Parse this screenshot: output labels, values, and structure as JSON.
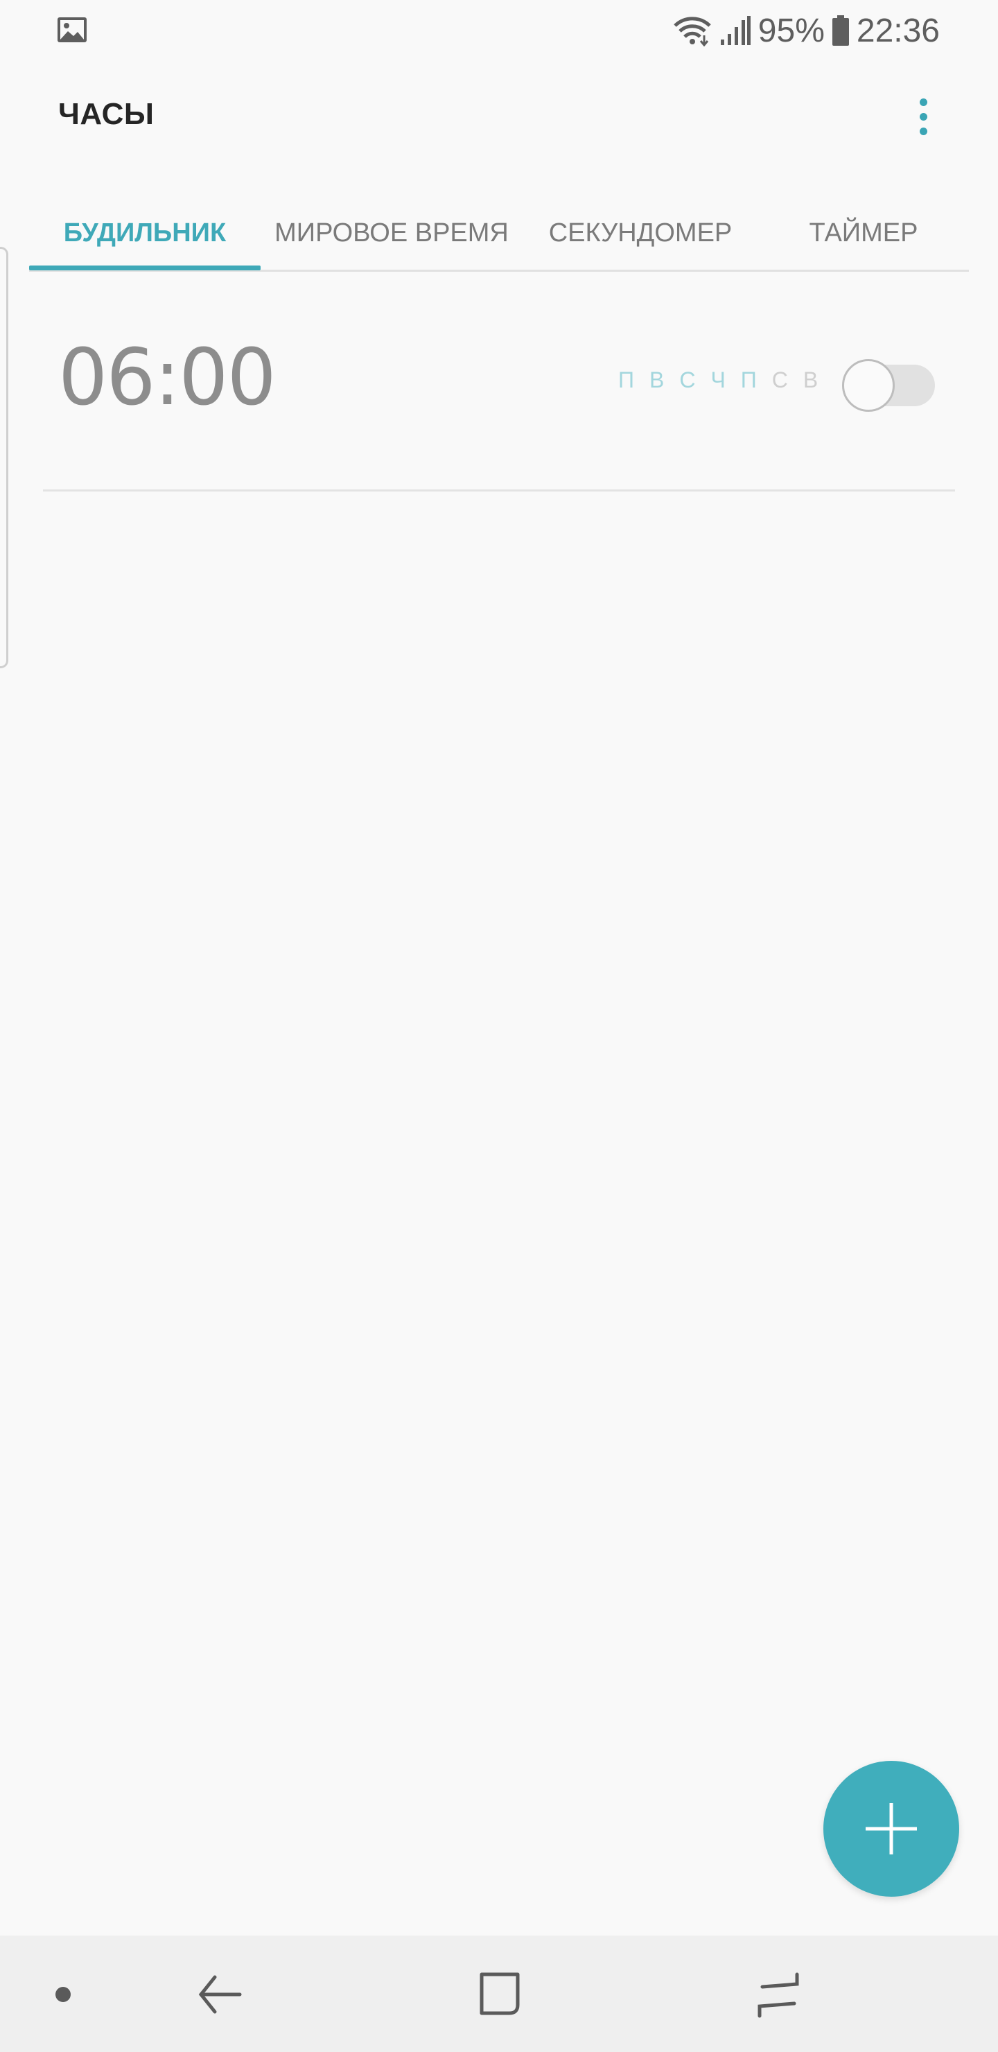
{
  "status_bar": {
    "left_icon": "image-icon",
    "wifi_icon": "wifi-icon",
    "signal_icon": "signal-icon",
    "battery_percent": "95%",
    "battery_icon": "battery-icon",
    "time": "22:36"
  },
  "app_bar": {
    "title": "ЧАСЫ",
    "more_icon": "more-vertical-icon"
  },
  "tabs": [
    {
      "label": "БУДИЛЬНИК",
      "active": true
    },
    {
      "label": "МИРОВОЕ ВРЕМЯ",
      "active": false
    },
    {
      "label": "СЕКУНДОМЕР",
      "active": false
    },
    {
      "label": "ТАЙМЕР",
      "active": false
    }
  ],
  "alarms": [
    {
      "time": "06:00",
      "days": [
        "П",
        "В",
        "С",
        "Ч",
        "П",
        "С",
        "В"
      ],
      "enabled": false
    }
  ],
  "fab": {
    "icon": "plus-icon"
  },
  "nav_bar": {
    "items": [
      "dot-icon",
      "back-icon",
      "home-icon",
      "recents-icon"
    ]
  },
  "colors": {
    "accent": "#3fa9b8",
    "background": "#f9f9f9",
    "fab": "#40aebc",
    "nav_bar": "#efefef"
  }
}
